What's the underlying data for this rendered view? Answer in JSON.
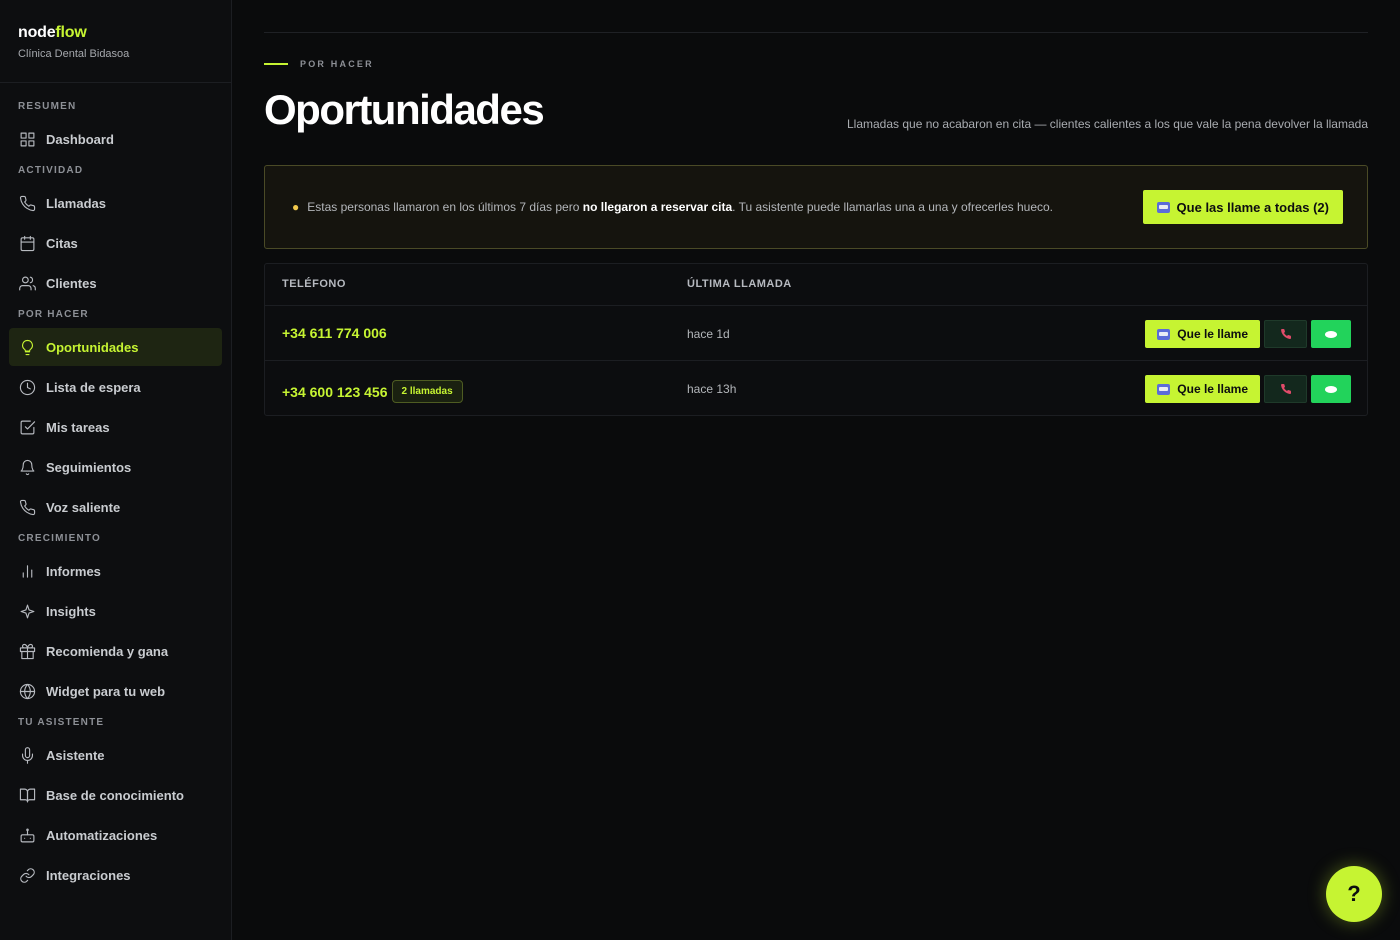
{
  "brand": {
    "name_prefix": "node",
    "name_suffix": "flow",
    "subtitle": "Clínica Dental Bidasoa"
  },
  "sidebar": {
    "sections": [
      {
        "title": "RESUMEN",
        "items": [
          {
            "label": "Dashboard",
            "icon": "grid-icon"
          }
        ]
      },
      {
        "title": "ACTIVIDAD",
        "items": [
          {
            "label": "Llamadas",
            "icon": "phone-icon"
          },
          {
            "label": "Citas",
            "icon": "calendar-icon"
          },
          {
            "label": "Clientes",
            "icon": "users-icon"
          }
        ]
      },
      {
        "title": "POR HACER",
        "items": [
          {
            "label": "Oportunidades",
            "icon": "lightbulb-icon",
            "active": true
          },
          {
            "label": "Lista de espera",
            "icon": "clock-icon"
          },
          {
            "label": "Mis tareas",
            "icon": "checkbox-icon"
          },
          {
            "label": "Seguimientos",
            "icon": "bell-icon"
          },
          {
            "label": "Voz saliente",
            "icon": "phone-outgoing-icon"
          }
        ]
      },
      {
        "title": "CRECIMIENTO",
        "items": [
          {
            "label": "Informes",
            "icon": "bar-chart-icon"
          },
          {
            "label": "Insights",
            "icon": "sparkle-icon"
          },
          {
            "label": "Recomienda y gana",
            "icon": "gift-icon"
          },
          {
            "label": "Widget para tu web",
            "icon": "globe-icon"
          }
        ]
      },
      {
        "title": "TU ASISTENTE",
        "items": [
          {
            "label": "Asistente",
            "icon": "microphone-icon"
          },
          {
            "label": "Base de conocimiento",
            "icon": "book-icon"
          },
          {
            "label": "Automatizaciones",
            "icon": "robot-icon"
          },
          {
            "label": "Integraciones",
            "icon": "link-icon"
          }
        ]
      }
    ]
  },
  "header": {
    "eyebrow": "POR HACER",
    "title": "Oportunidades",
    "subtitle": "Llamadas que no acabaron en cita — clientes calientes a los que vale la pena devolver la llamada"
  },
  "banner": {
    "text_before": "Estas personas llamaron en los últimos 7 días pero ",
    "text_bold": "no llegaron a reservar cita",
    "text_after": ". Tu asistente puede llamarlas una a una y ofrecerles hueco.",
    "button_label": "Que las llame a todas (2)"
  },
  "table": {
    "columns": [
      "TELÉFONO",
      "ÚLTIMA LLAMADA"
    ],
    "rows": [
      {
        "phone": "+34 611 774 006",
        "badge": "",
        "last_call": "hace 1d",
        "action_label": "Que le llame"
      },
      {
        "phone": "+34 600 123 456",
        "badge": "2 llamadas",
        "last_call": "hace 13h",
        "action_label": "Que le llame"
      }
    ]
  },
  "help": {
    "label": "?"
  },
  "colors": {
    "accent": "#c6f432",
    "whatsapp": "#22d35b",
    "call_icon": "#e24b6a"
  }
}
